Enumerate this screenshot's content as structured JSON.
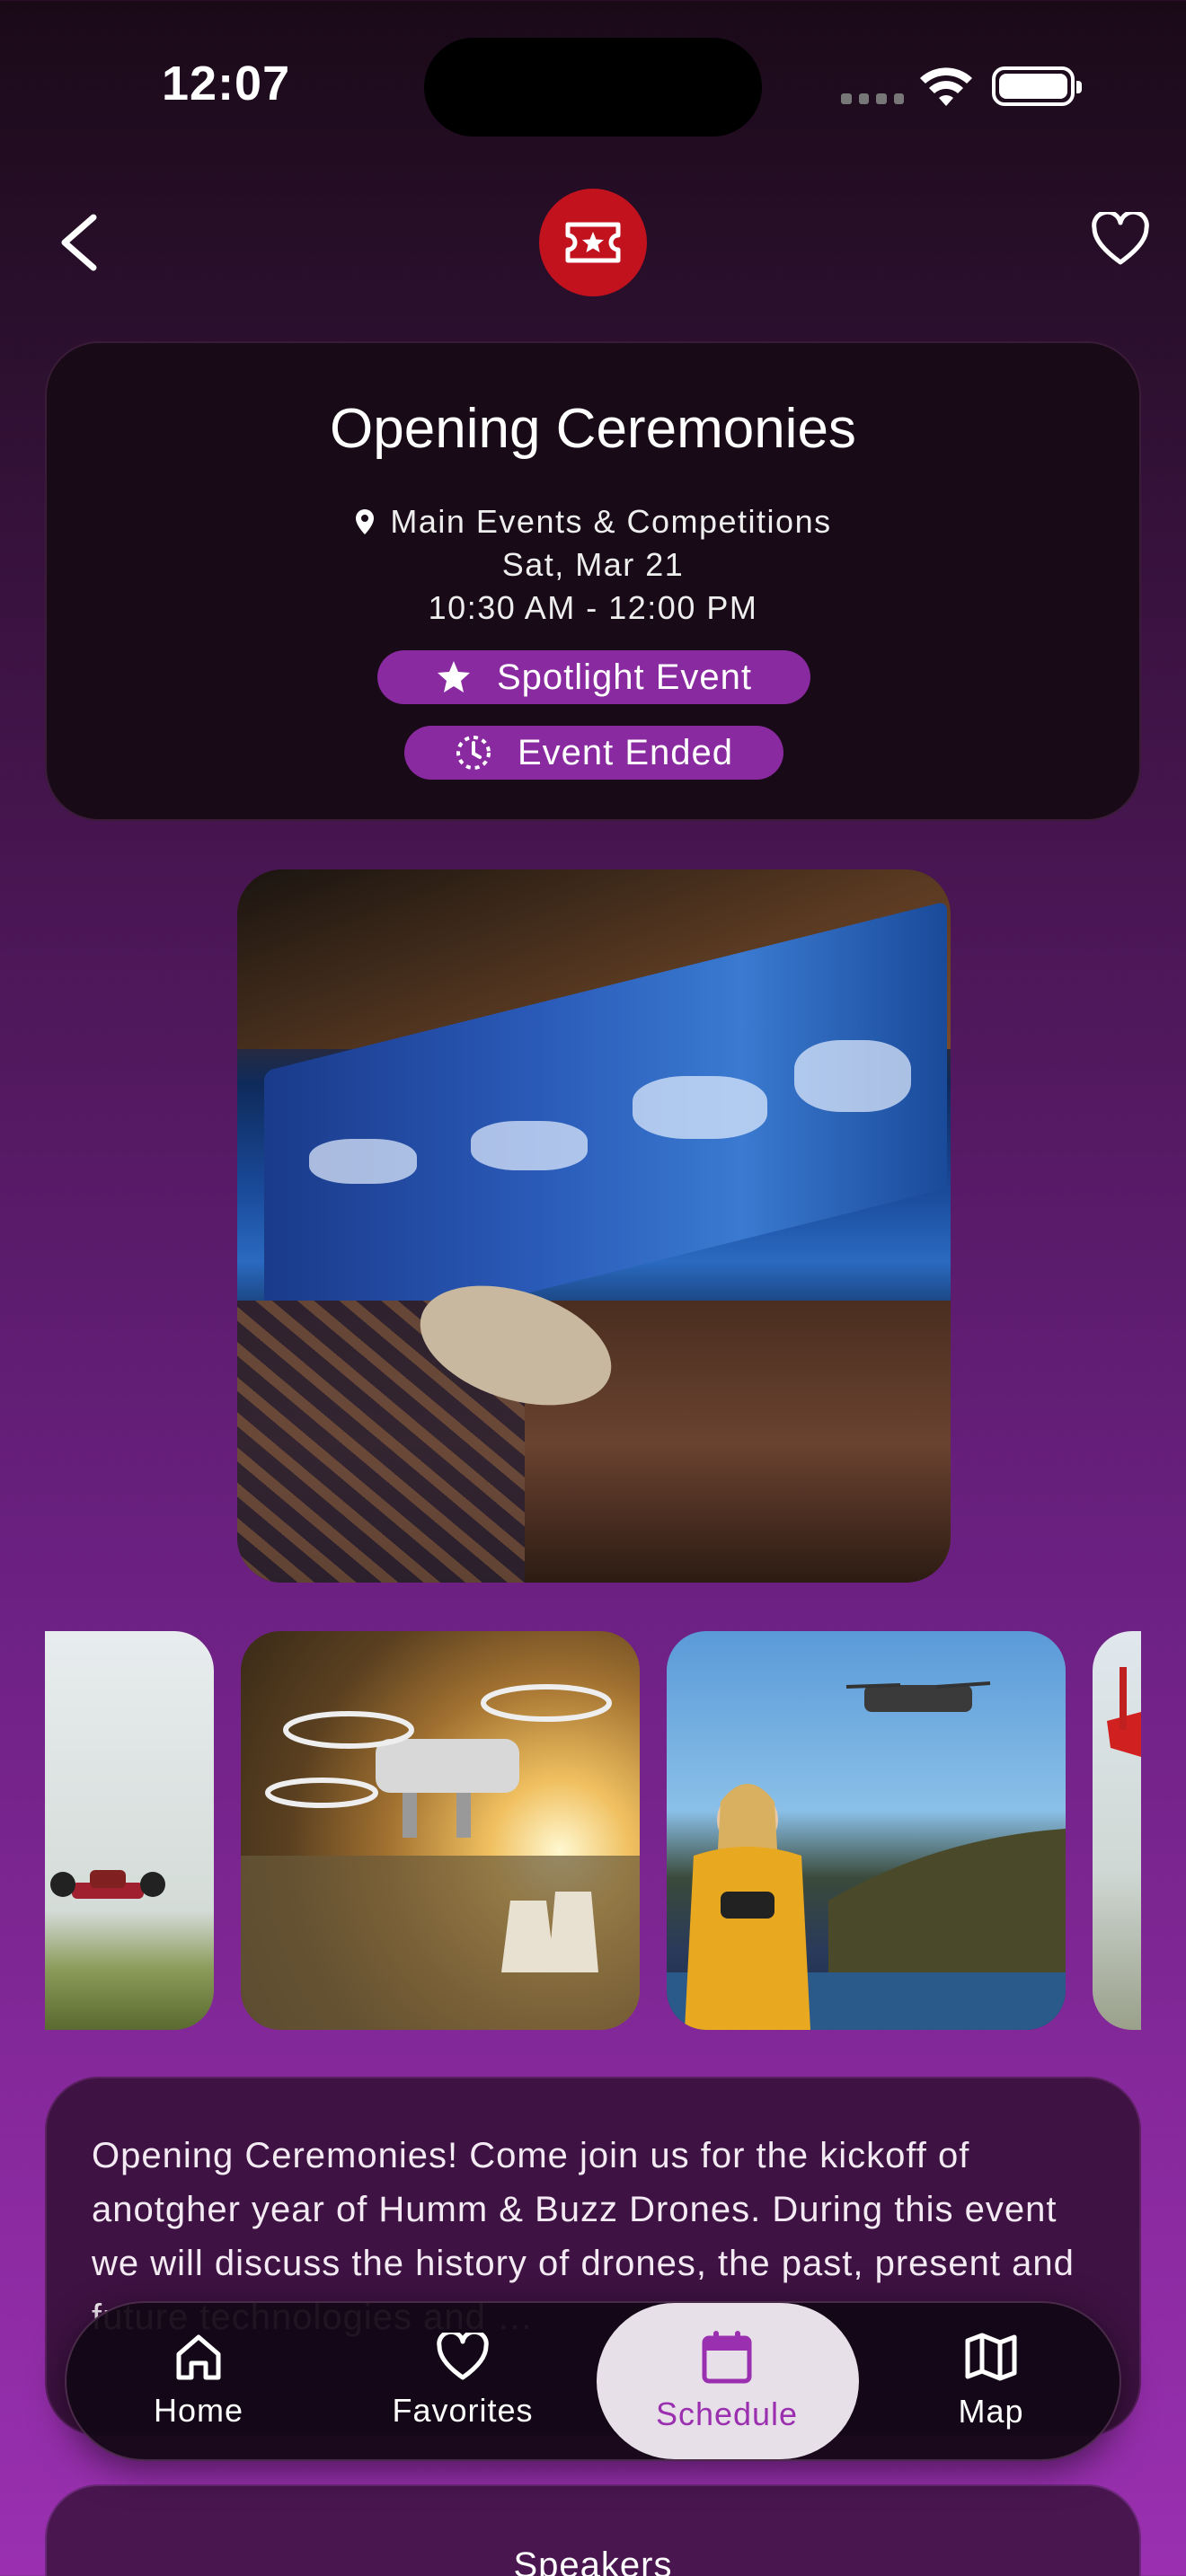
{
  "status_bar": {
    "time": "12:07"
  },
  "header": {
    "back_icon": "chevron-left-icon",
    "badge_icon": "ticket-star-icon",
    "favorite_icon": "heart-outline-icon"
  },
  "event": {
    "title": "Opening Ceremonies",
    "location": "Main Events & Competitions",
    "date": "Sat, Mar 21",
    "time_range": "10:30 AM - 12:00 PM",
    "tags": [
      {
        "label": "Spotlight Event",
        "icon": "star-icon"
      },
      {
        "label": "Event Ended",
        "icon": "clock-dashed-icon"
      }
    ]
  },
  "description": "Opening Ceremonies! Come join us for the kickoff of anotgher year of Humm & Buzz Drones.  During this event we will discuss the history of drones, the past, present and future technologies and …",
  "tabs": [
    {
      "label": "Home",
      "icon": "home-icon"
    },
    {
      "label": "Favorites",
      "icon": "heart-icon"
    },
    {
      "label": "Schedule",
      "icon": "calendar-icon",
      "active": true
    },
    {
      "label": "Map",
      "icon": "map-icon"
    }
  ],
  "speakers": {
    "title": "Speakers"
  },
  "colors": {
    "accent": "#8a2aa0",
    "badge": "#c2121e",
    "active_tab_bg": "#e8e0e8",
    "active_tab_fg": "#9a30b0"
  }
}
